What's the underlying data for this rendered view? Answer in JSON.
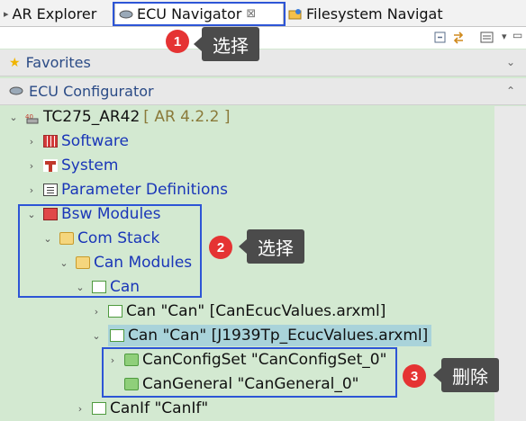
{
  "tabs": [
    {
      "label": "AR Explorer",
      "icon": "ar-explorer-icon"
    },
    {
      "label": "ECU Navigator",
      "icon": "ecu-navigator-icon",
      "active": true
    },
    {
      "label": "Filesystem Navigat",
      "icon": "filesystem-icon"
    }
  ],
  "sections": {
    "favorites": "Favorites",
    "ecu_configurator": "ECU Configurator"
  },
  "tree": {
    "root": {
      "label": "TC275_AR42",
      "suffix": "[ AR 4.2.2 ]"
    },
    "software": "Software",
    "system": "System",
    "parameter_definitions": "Parameter Definitions",
    "bsw_modules": "Bsw Modules",
    "com_stack": "Com Stack",
    "can_modules": "Can Modules",
    "can": "Can",
    "can_ecuc": "Can \"Can\" [CanEcucValues.arxml]",
    "can_j1939": "Can \"Can\" [J1939Tp_EcucValues.arxml]",
    "can_config_set": "CanConfigSet \"CanConfigSet_0\"",
    "can_general": "CanGeneral \"CanGeneral_0\"",
    "canif": "CanIf \"CanIf\""
  },
  "annotations": [
    {
      "number": "1",
      "text": "选择"
    },
    {
      "number": "2",
      "text": "选择"
    },
    {
      "number": "3",
      "text": "删除"
    }
  ],
  "colors": {
    "highlight_border": "#2d55d6",
    "badge": "#e53333",
    "callout": "#4b4b4b",
    "tree_bg": "#d3e9d1",
    "selected_row": "#a9d3da"
  }
}
